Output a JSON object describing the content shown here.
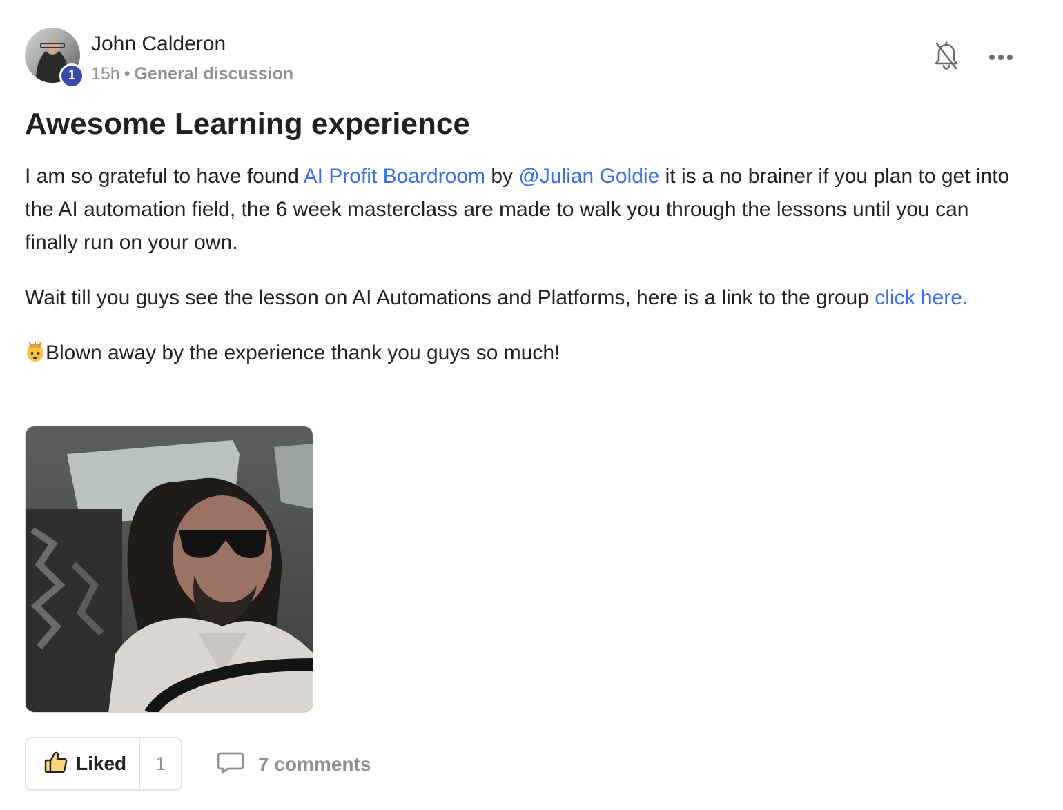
{
  "author": {
    "name": "John Calderon",
    "level": "1",
    "avatar_icon": "user-avatar"
  },
  "meta": {
    "time": "15h",
    "separator": "•",
    "category": "General discussion"
  },
  "actions": {
    "bell_icon": "bell-muted-icon",
    "more_icon": "more-horizontal-icon"
  },
  "post": {
    "title": "Awesome Learning experience",
    "p1": {
      "t1": "I am so grateful to have found ",
      "link1": "AI Profit Boardroom",
      "t2": " by ",
      "mention": "@Julian Goldie",
      "t3": " it is a no brainer if you plan to get into the AI automation field, the 6 week masterclass are made to walk you through the lessons until you can finally run on your own."
    },
    "p2": {
      "t1": "Wait till you guys see the lesson on AI Automations and Platforms, here is a link to the group ",
      "link": "click here."
    },
    "p3": {
      "emoji": "exploding-head-emoji",
      "text": "Blown away by the experience thank you guys so much!"
    },
    "image_alt": "gif"
  },
  "footer": {
    "like_label": "Liked",
    "like_count": "1",
    "comments_label": "7 comments"
  },
  "colors": {
    "link": "#3a6ee8",
    "badge": "#3a4aa8",
    "muted": "#909090",
    "text": "#202124"
  }
}
